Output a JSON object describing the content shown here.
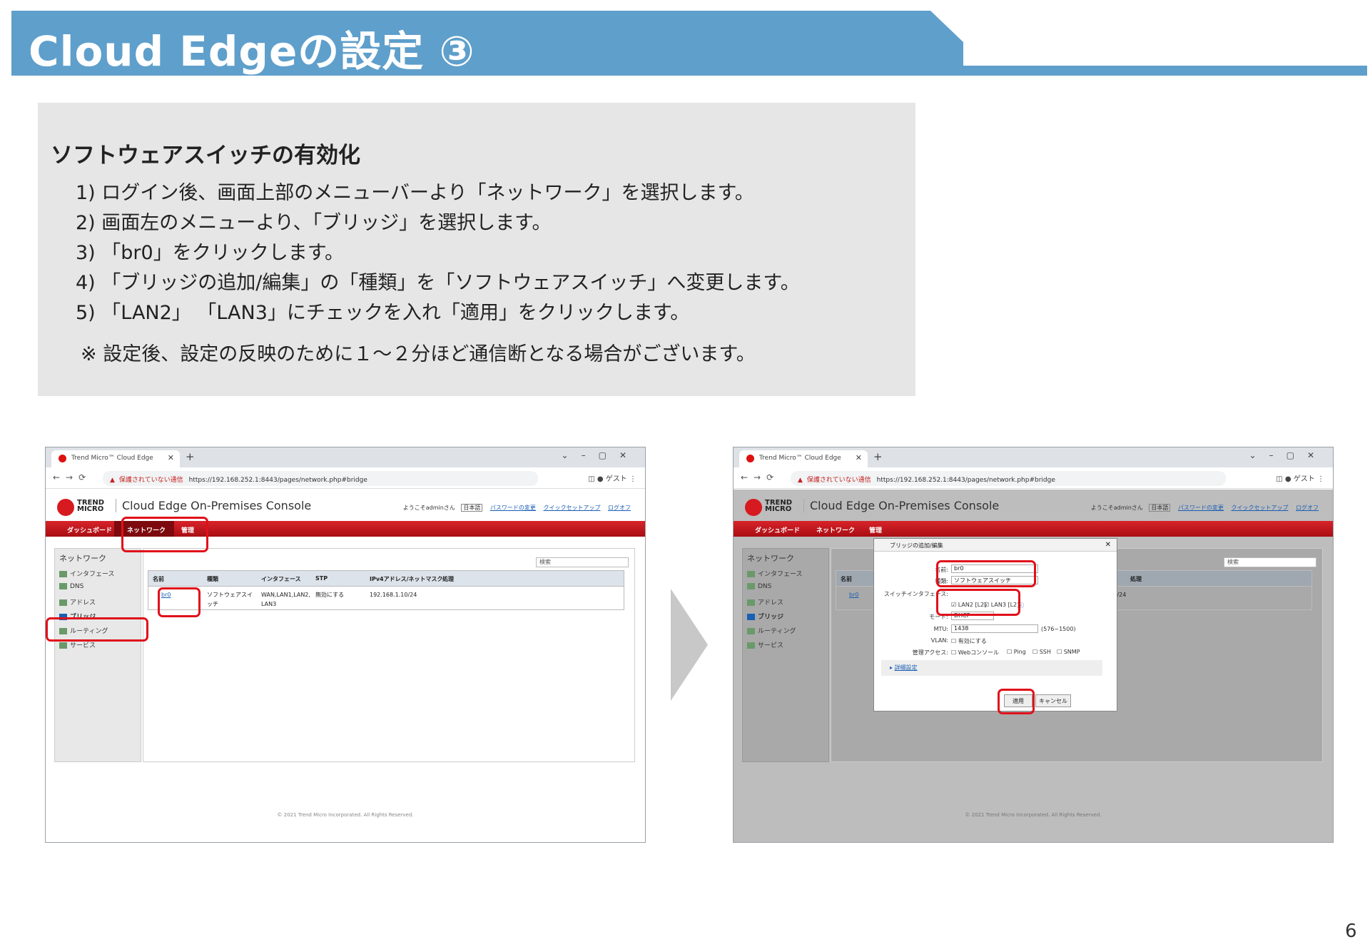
{
  "header": {
    "title": "Cloud Edgeの設定 ③"
  },
  "instructions": {
    "heading": "ソフトウェアスイッチの有効化",
    "steps": [
      "1) ログイン後、画面上部のメニューバーより「ネットワーク」を選択します。",
      "2) 画面左のメニューより、「ブリッジ」を選択します。",
      "3) 「br0」をクリックします。",
      "4) 「ブリッジの追加/編集」の「種類」を「ソフトウェアスイッチ」へ変更します。",
      "5) 「LAN2」 「LAN3」にチェックを入れ「適用」をクリックします。"
    ],
    "note": "※ 設定後、設定の反映のために１～２分ほど通信断となる場合がございます。"
  },
  "browser": {
    "tab_title": "Trend Micro™ Cloud Edge",
    "warning": "保護されていない通信",
    "url": "https://192.168.252.1:8443/pages/network.php#bridge",
    "guest": "ゲスト"
  },
  "console": {
    "logo_text": "TREND MICRO",
    "title": "Cloud Edge On-Premises Console",
    "welcome": "ようこそadminさん",
    "language": "日本語",
    "links": [
      "パスワードの変更",
      "クイックセットアップ",
      "ログオフ"
    ],
    "menu": [
      "ダッシュボード",
      "ネットワーク",
      "管理"
    ],
    "footer": "© 2021 Trend Micro Incorporated. All Rights Reserved."
  },
  "sidebar": {
    "title": "ネットワーク",
    "items": [
      "インタフェース",
      "DNS",
      "アドレス",
      "ブリッジ",
      "ルーティング",
      "サービス"
    ]
  },
  "table": {
    "search": "検索",
    "columns": [
      "名前",
      "種類",
      "インタフェース",
      "STP",
      "IPv4アドレス/ネットマスク",
      "処理"
    ],
    "row": {
      "name": "br0",
      "type": "ソフトウェアスイッチ",
      "interfaces": "WAN,LAN1,LAN2,LAN3",
      "stp": "無効にする",
      "ipv4": "192.168.1.10/24"
    }
  },
  "dialog": {
    "title": "ブリッジの追加/編集",
    "name_label": "名前:",
    "name_value": "br0",
    "type_label": "種類:",
    "type_value": "ソフトウェアスイッチ",
    "switch_label": "スイッチインタフェース:",
    "lan2": "LAN2 [L2]",
    "lan3": "LAN3 [L2]",
    "mode_label": "モード:",
    "mode_value": "DHCP",
    "mtu_label": "MTU:",
    "mtu_value": "1438",
    "mtu_range": "(576~1500)",
    "vlan_label": "VLAN:",
    "vlan_option": "有効にする",
    "access_label": "管理アクセス:",
    "access_options": [
      "Webコンソール",
      "Ping",
      "SSH",
      "SNMP"
    ],
    "advanced": "詳細設定",
    "apply": "適用",
    "cancel": "キャンセル"
  },
  "page_number": "6"
}
